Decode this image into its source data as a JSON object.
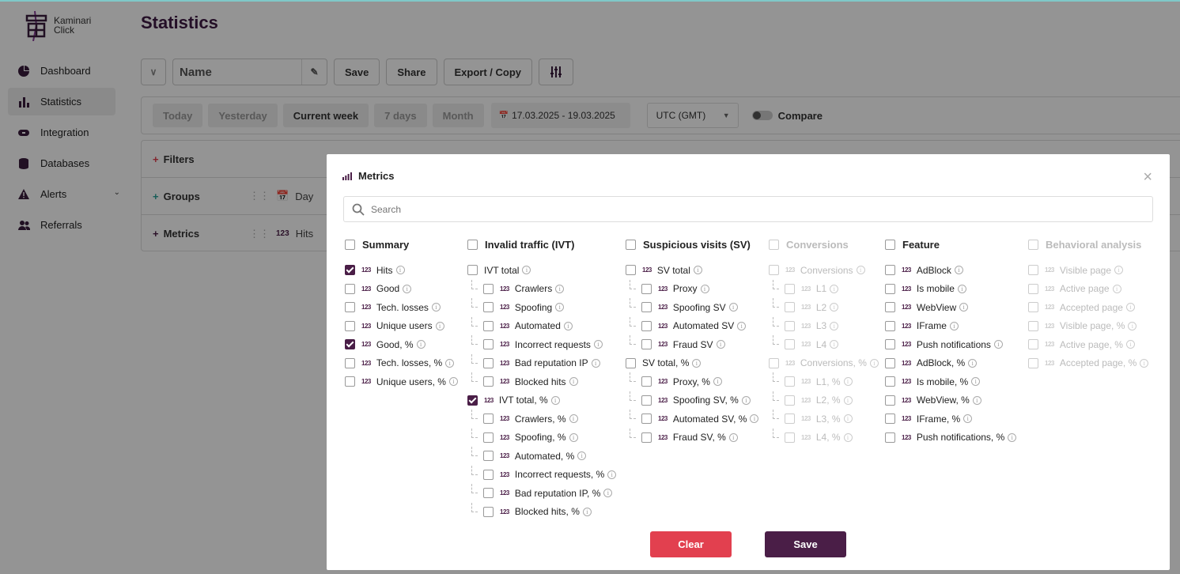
{
  "brand": {
    "line1": "Kaminari",
    "line2": "Click"
  },
  "sidebar": {
    "items": [
      {
        "label": "Dashboard",
        "icon": "pie-chart-icon"
      },
      {
        "label": "Statistics",
        "icon": "bar-chart-icon",
        "active": true
      },
      {
        "label": "Integration",
        "icon": "link-icon"
      },
      {
        "label": "Databases",
        "icon": "database-icon"
      },
      {
        "label": "Alerts",
        "icon": "warning-icon"
      },
      {
        "label": "Referrals",
        "icon": "users-icon"
      }
    ]
  },
  "page": {
    "title": "Statistics"
  },
  "toolbar": {
    "name_value": "Name",
    "save": "Save",
    "share": "Share",
    "export": "Export / Copy"
  },
  "dates": {
    "today": "Today",
    "yesterday": "Yesterday",
    "current_week": "Current week",
    "seven_days": "7 days",
    "month": "Month",
    "range": "17.03.2025 - 19.03.2025",
    "timezone": "UTC (GMT)",
    "compare": "Compare"
  },
  "panel": {
    "filters": "Filters",
    "groups": "Groups",
    "groups_chip": "Day",
    "metrics": "Metrics",
    "metrics_chip": "Hits"
  },
  "modal": {
    "title": "Metrics",
    "search_placeholder": "Search",
    "clear": "Clear",
    "save": "Save",
    "columns": [
      {
        "title": "Summary",
        "disabled": false,
        "items": [
          {
            "label": "Hits",
            "checked": true
          },
          {
            "label": "Good"
          },
          {
            "label": "Tech. losses"
          },
          {
            "label": "Unique users"
          },
          {
            "label": "Good, %",
            "checked": true
          },
          {
            "label": "Tech. losses, %"
          },
          {
            "label": "Unique users, %"
          }
        ]
      },
      {
        "title": "Invalid traffic (IVT)",
        "disabled": false,
        "items": [
          {
            "label": "IVT total",
            "nonum": true
          },
          {
            "label": "Crawlers",
            "sub": true
          },
          {
            "label": "Spoofing",
            "sub": true
          },
          {
            "label": "Automated",
            "sub": true
          },
          {
            "label": "Incorrect requests",
            "sub": true
          },
          {
            "label": "Bad reputation IP",
            "sub": true
          },
          {
            "label": "Blocked hits",
            "sub": true
          },
          {
            "label": "IVT total, %",
            "checked": true
          },
          {
            "label": "Crawlers, %",
            "sub": true
          },
          {
            "label": "Spoofing, %",
            "sub": true
          },
          {
            "label": "Automated, %",
            "sub": true
          },
          {
            "label": "Incorrect requests, %",
            "sub": true
          },
          {
            "label": "Bad reputation IP, %",
            "sub": true
          },
          {
            "label": "Blocked hits, %",
            "sub": true
          }
        ]
      },
      {
        "title": "Suspicious visits (SV)",
        "disabled": false,
        "items": [
          {
            "label": "SV total"
          },
          {
            "label": "Proxy",
            "sub": true
          },
          {
            "label": "Spoofing SV",
            "sub": true
          },
          {
            "label": "Automated SV",
            "sub": true
          },
          {
            "label": "Fraud SV",
            "sub": true
          },
          {
            "label": "SV total, %",
            "nonum": true
          },
          {
            "label": "Proxy, %",
            "sub": true
          },
          {
            "label": "Spoofing SV, %",
            "sub": true
          },
          {
            "label": "Automated SV, %",
            "sub": true
          },
          {
            "label": "Fraud SV, %",
            "sub": true
          }
        ]
      },
      {
        "title": "Conversions",
        "disabled": true,
        "items": [
          {
            "label": "Conversions"
          },
          {
            "label": "L1",
            "sub": true
          },
          {
            "label": "L2",
            "sub": true
          },
          {
            "label": "L3",
            "sub": true
          },
          {
            "label": "L4",
            "sub": true
          },
          {
            "label": "Conversions, %"
          },
          {
            "label": "L1, %",
            "sub": true
          },
          {
            "label": "L2, %",
            "sub": true
          },
          {
            "label": "L3, %",
            "sub": true
          },
          {
            "label": "L4, %",
            "sub": true
          }
        ]
      },
      {
        "title": "Feature",
        "disabled": false,
        "items": [
          {
            "label": "AdBlock"
          },
          {
            "label": "Is mobile"
          },
          {
            "label": "WebView"
          },
          {
            "label": "IFrame"
          },
          {
            "label": "Push notifications"
          },
          {
            "label": "AdBlock, %"
          },
          {
            "label": "Is mobile, %"
          },
          {
            "label": "WebView, %"
          },
          {
            "label": "IFrame, %"
          },
          {
            "label": "Push notifications, %"
          }
        ]
      },
      {
        "title": "Behavioral analysis",
        "disabled": true,
        "items": [
          {
            "label": "Visible page"
          },
          {
            "label": "Active page"
          },
          {
            "label": "Accepted page"
          },
          {
            "label": "Visible page, %"
          },
          {
            "label": "Active page, %"
          },
          {
            "label": "Accepted page, %"
          }
        ]
      }
    ]
  },
  "colors": {
    "brand": "#4a1e47",
    "clear": "#e2404f",
    "title": "#3f1b44"
  }
}
